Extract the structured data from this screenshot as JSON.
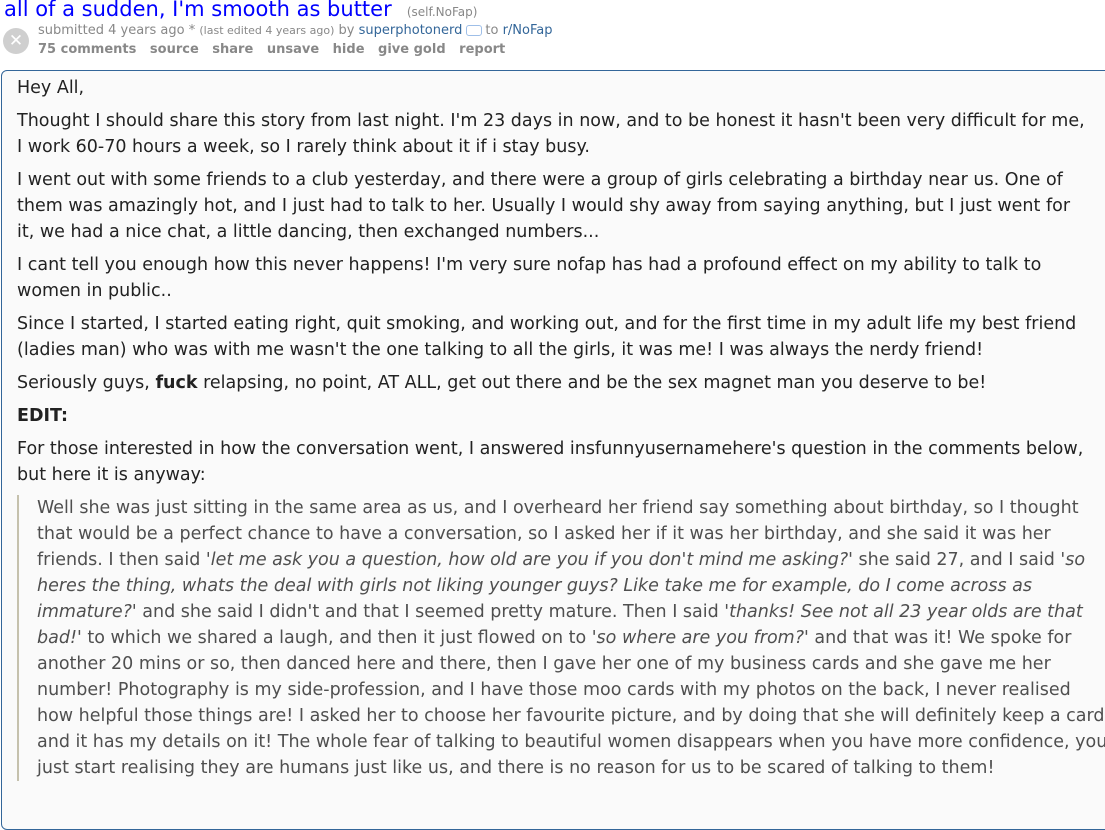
{
  "post": {
    "title": "all of a sudden, I'm smooth as butter",
    "domain": "(self.NoFap)",
    "thumb_symbol": "✕",
    "submitted": "submitted 4 years ago",
    "edited_marker": "*",
    "last_edited": "(last edited 4 years ago)",
    "by": "by",
    "author": "superphotonerd",
    "to": "to",
    "subreddit": "r/NoFap"
  },
  "buttons": {
    "comments": "75 comments",
    "source": "source",
    "share": "share",
    "unsave": "unsave",
    "hide": "hide",
    "give_gold": "give gold",
    "report": "report"
  },
  "body": {
    "p1": "Hey All,",
    "p2": "Thought I should share this story from last night. I'm 23 days in now, and to be honest it hasn't been very difficult for me, I work 60-70 hours a week, so I rarely think about it if i stay busy.",
    "p3": "I went out with some friends to a club yesterday, and there were a group of girls celebrating a birthday near us. One of them was amazingly hot, and I just had to talk to her. Usually I would shy away from saying anything, but I just went for it, we had a nice chat, a little dancing, then exchanged numbers...",
    "p4": "I cant tell you enough how this never happens! I'm very sure nofap has had a profound effect on my ability to talk to women in public..",
    "p5": "Since I started, I started eating right, quit smoking, and working out, and for the first time in my adult life my best friend (ladies man) who was with me wasn't the one talking to all the girls, it was me! I was always the nerdy friend!",
    "p6_a": "Seriously guys, ",
    "p6_bold": "fuck",
    "p6_b": " relapsing, no point, AT ALL, get out there and be the sex magnet man you deserve to be!",
    "edit": "EDIT:",
    "p7": "For those interested in how the conversation went, I answered insfunnyusernamehere's question in the comments below, but here it is anyway:",
    "quote": {
      "t1": "Well she was just sitting in the same area as us, and I overheard her friend say something about birthday, so I thought that would be a perfect chance to have a conversation, so I asked her if it was her birthday, and she said it was her friends. I then said ",
      "i1": "'let me ask you a question, how old are you if you don't mind me asking?'",
      "t2": " she said 27, and I said ",
      "i2": "'so heres the thing, whats the deal with girls not liking younger guys? Like take me for example, do I come across as immature?'",
      "t3": " and she said I didn't and that I seemed pretty mature. Then I said ",
      "i3": "'thanks! See not all 23 year olds are that bad!'",
      "t4": " to which we shared a laugh, and then it just flowed on to ",
      "i4": "'so where are you from?'",
      "t5": " and that was it! We spoke for another 20 mins or so, then danced here and there, then I gave her one of my business cards and she gave me her number! Photography is my side-profession, and I have those moo cards with my photos on the back, I never realised how helpful those things are! I asked her to choose her favourite picture, and by doing that she will definitely keep a card, and it has my details on it! The whole fear of talking to beautiful women disappears when you have more confidence, you just start realising they are humans just like us, and there is no reason for us to be scared of talking to them!"
    }
  }
}
